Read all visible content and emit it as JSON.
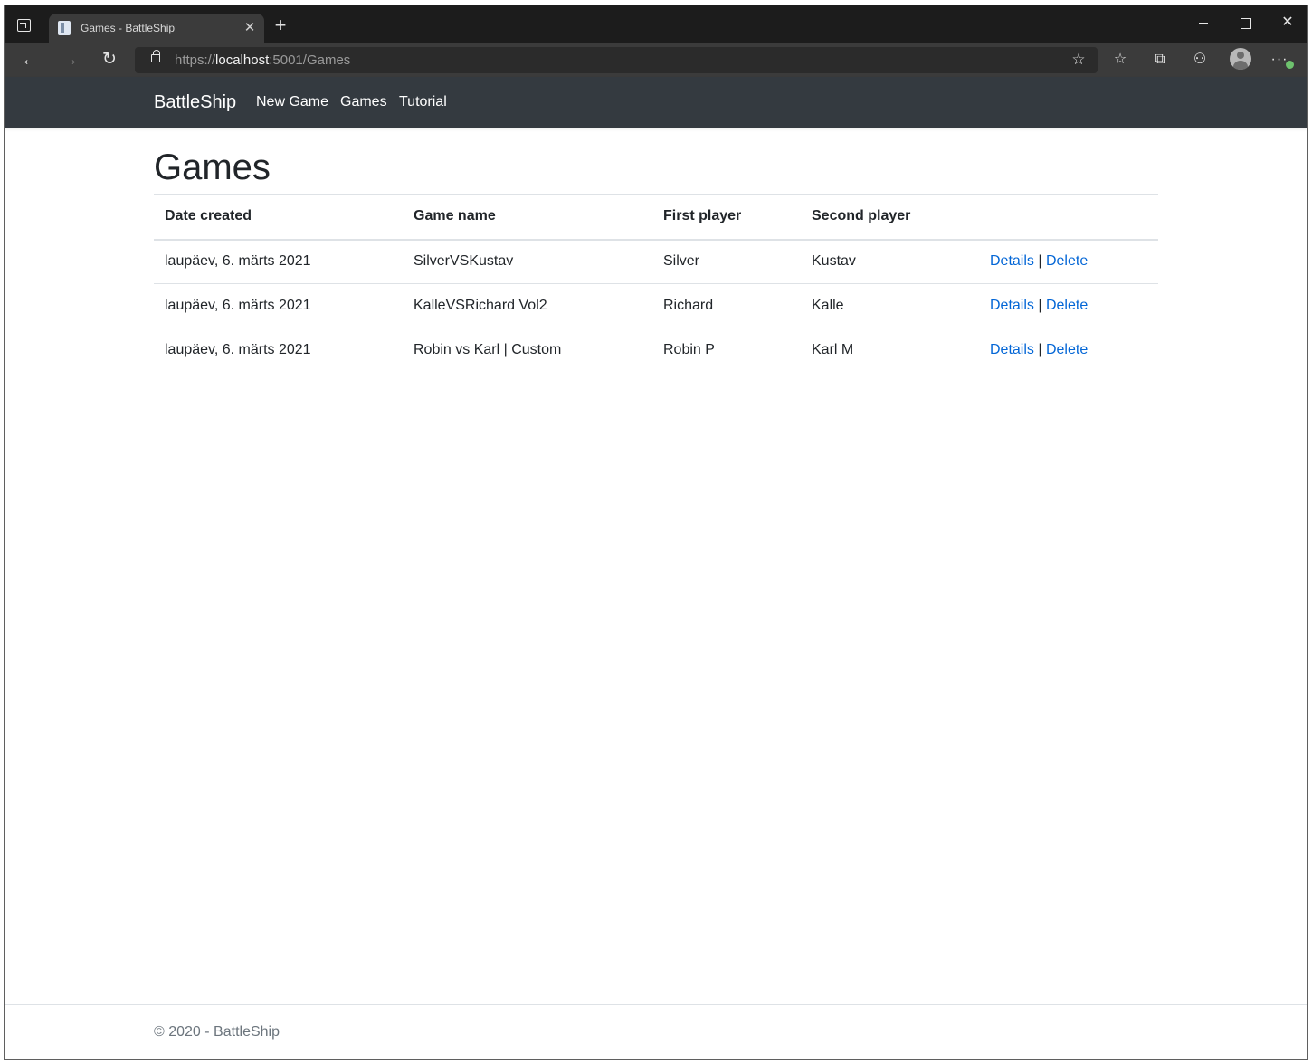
{
  "browser": {
    "tab_title": "Games - BattleShip",
    "url_scheme": "https://",
    "url_host": "localhost",
    "url_rest": ":5001/Games",
    "icons": {
      "tab_actions": "tab-actions-icon",
      "favicon": "page-favicon-icon",
      "tab_close": "close-icon",
      "new_tab": "plus-icon",
      "back": "arrow-left-icon",
      "forward": "arrow-right-icon",
      "reload": "reload-icon",
      "lock": "lock-icon",
      "add_favorite": "star-plus-icon",
      "favorites": "favorites-list-icon",
      "collections": "collections-icon",
      "extensions": "extensions-icon",
      "profile": "profile-avatar-icon",
      "more": "more-dots-icon"
    },
    "glyphs": {
      "close": "✕",
      "plus": "+",
      "back": "←",
      "forward": "→",
      "reload": "↻",
      "star_plus": "☆",
      "favorites": "☆",
      "collections": "⧉",
      "extensions": "⚇",
      "more": "···"
    }
  },
  "navbar": {
    "brand": "BattleShip",
    "links": [
      "New Game",
      "Games",
      "Tutorial"
    ]
  },
  "main": {
    "title": "Games",
    "table": {
      "headers": [
        "Date created",
        "Game name",
        "First player",
        "Second player",
        ""
      ],
      "rows": [
        {
          "date": "laupäev, 6. märts 2021",
          "name": "SilverVSKustav",
          "first": "Silver",
          "second": "Kustav",
          "details": "Details",
          "sep": "|",
          "delete": "Delete"
        },
        {
          "date": "laupäev, 6. märts 2021",
          "name": "KalleVSRichard Vol2",
          "first": "Richard",
          "second": "Kalle",
          "details": "Details",
          "sep": "|",
          "delete": "Delete"
        },
        {
          "date": "laupäev, 6. märts 2021",
          "name": "Robin vs Karl | Custom",
          "first": "Robin P",
          "second": "Karl M",
          "details": "Details",
          "sep": "|",
          "delete": "Delete"
        }
      ]
    }
  },
  "footer": {
    "text": "© 2020 - BattleShip"
  },
  "colors": {
    "navbar_bg": "#343a40",
    "link": "#0366d6",
    "text": "#212529",
    "footer_text": "#6c757d"
  }
}
